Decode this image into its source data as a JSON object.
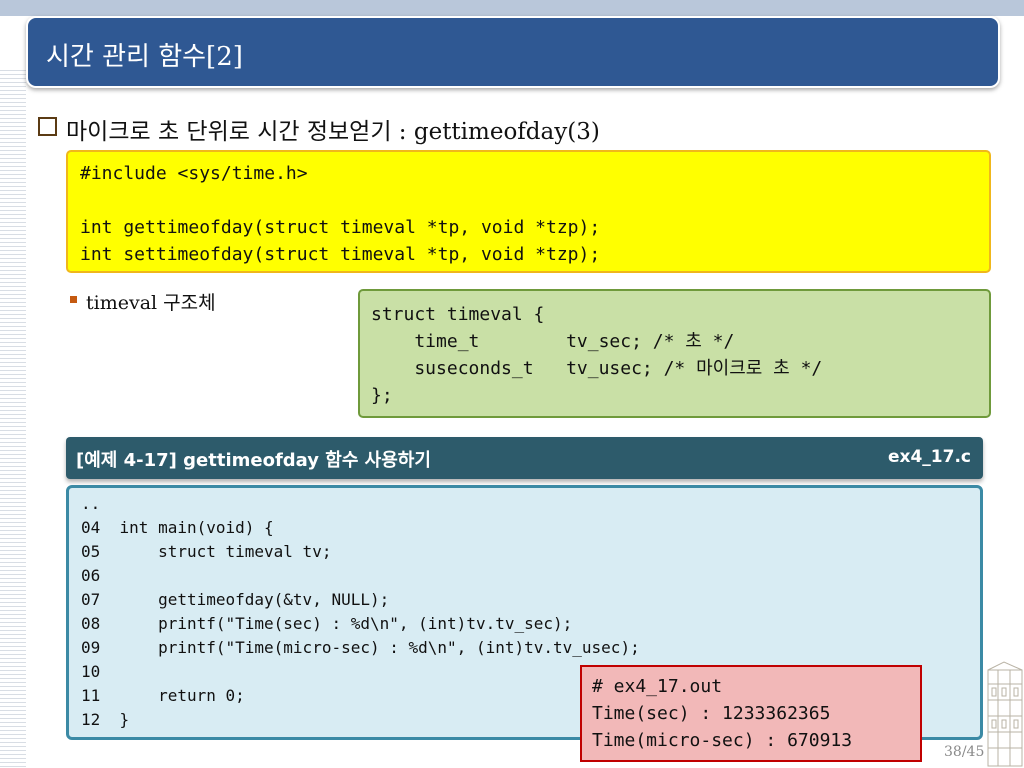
{
  "slide": {
    "title": "시간 관리 함수[2]",
    "heading": "마이크로 초 단위로 시간 정보얻기 : gettimeofday(3)",
    "page": "38/45"
  },
  "synopsis": {
    "lines": [
      "#include <sys/time.h>",
      "",
      "int gettimeofday(struct timeval *tp, void *tzp);",
      "int settimeofday(struct timeval *tp, void *tzp);"
    ]
  },
  "struct_section": {
    "bullet_label": "timeval 구조체",
    "lines": [
      "struct timeval {",
      "    time_t        tv_sec; /* 초 */",
      "    suseconds_t   tv_usec; /* 마이크로 초 */",
      "};"
    ]
  },
  "example": {
    "title": "[예제 4-17] gettimeofday 함수 사용하기",
    "filename": "ex4_17.c",
    "listing": [
      "..",
      "04  int main(void) {",
      "05      struct timeval tv;",
      "06",
      "07      gettimeofday(&tv, NULL);",
      "08      printf(\"Time(sec) : %d\\n\", (int)tv.tv_sec);",
      "09      printf(\"Time(micro-sec) : %d\\n\", (int)tv.tv_usec);",
      "10",
      "11      return 0;",
      "12  }"
    ]
  },
  "output": {
    "lines": [
      "# ex4_17.out",
      "Time(sec) : 1233362365",
      "Time(micro-sec) : 670913"
    ]
  },
  "colors": {
    "title_bar": "#2f5893",
    "synopsis_bg": "#ffff00",
    "struct_bg": "#c9e0a6",
    "example_header": "#2d5b6b",
    "listing_bg": "#d8ecf3",
    "output_bg": "#f2b8b8"
  }
}
